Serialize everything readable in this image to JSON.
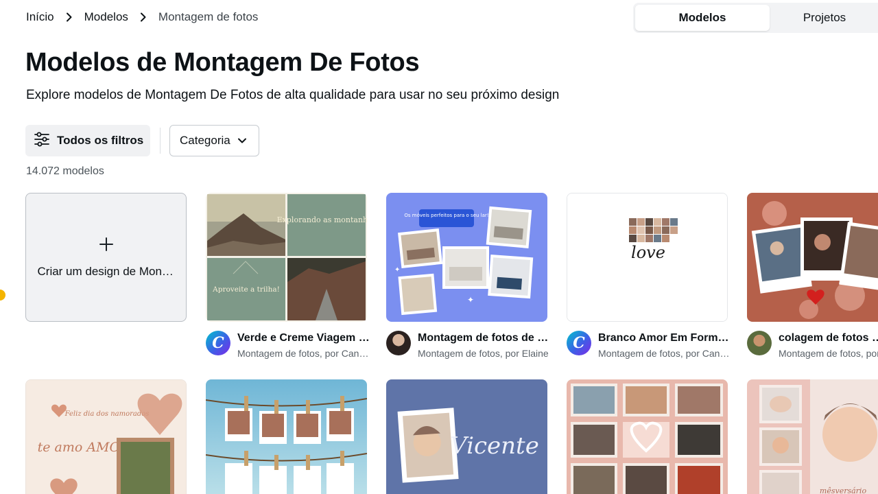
{
  "breadcrumb": {
    "home": "Início",
    "models": "Modelos",
    "current": "Montagem de fotos"
  },
  "tabs": {
    "models": "Modelos",
    "projects": "Projetos"
  },
  "page": {
    "title": "Modelos de Montagem De Fotos",
    "subtitle": "Explore modelos de Montagem De Fotos de alta qualidade para usar no seu próximo design"
  },
  "filters": {
    "all_filters": "Todos os filtros",
    "category": "Categoria",
    "count": "14.072 modelos"
  },
  "create_card": {
    "label": "Criar um design de Montagem de fotos"
  },
  "templates": [
    {
      "title": "Verde e Creme Viagem Montagem de fotos",
      "subtitle": "Montagem de fotos, por Canva Creative Studio",
      "avatar": "canva-logo",
      "inner_text_1": "Explorando as montanhas",
      "inner_text_2": "Aproveite a trilha!"
    },
    {
      "title": "Montagem de fotos de móveis",
      "subtitle": "Montagem de fotos, por Elaine",
      "avatar": "person-photo",
      "inner_text_1": "Os móveis perfeitos para o seu lar!"
    },
    {
      "title": "Branco Amor Em Formato de Coração",
      "subtitle": "Montagem de fotos, por Canva Creative Studio",
      "avatar": "canva-logo",
      "inner_text_1": "love"
    },
    {
      "title": "colagem de fotos casal",
      "subtitle": "Montagem de fotos, por",
      "avatar": "person-photo"
    }
  ],
  "row2": [
    {
      "inner_text_1": "Feliz dia dos namorados",
      "inner_text_2": "te amo AMOR"
    },
    {},
    {
      "inner_text_1": "Vicente"
    },
    {},
    {
      "inner_text_1": "mêsversário"
    }
  ]
}
